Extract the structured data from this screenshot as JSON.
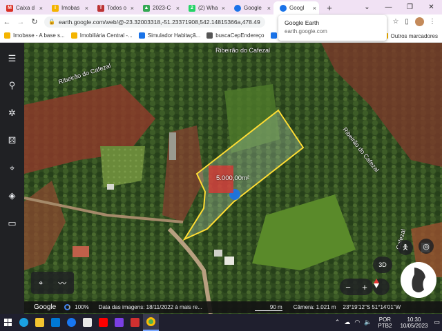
{
  "browser": {
    "tabs": [
      {
        "label": "Caixa d",
        "icon": "gmail-icon",
        "color": "#d93025",
        "letter": "M"
      },
      {
        "label": "Imobas",
        "icon": "imobase-icon",
        "color": "#f4b400",
        "letter": "i"
      },
      {
        "label": "Todos o",
        "icon": "todos-icon",
        "color": "#b33",
        "letter": "T"
      },
      {
        "label": "2023-C",
        "icon": "drive-icon",
        "color": "#34a853",
        "letter": "▲"
      },
      {
        "label": "(2) Wha",
        "icon": "whatsapp-icon",
        "color": "#25d366",
        "letter": "2"
      },
      {
        "label": "Google",
        "icon": "google-earth-icon",
        "color": "#1a73e8",
        "letter": ""
      },
      {
        "label": "Googl",
        "icon": "google-earth-icon",
        "color": "#1a73e8",
        "letter": "",
        "active": true
      }
    ],
    "new_tab": "+",
    "url": "earth.google.com/web/@-23.32003318,-51.23371908,542.14815366a,478.49",
    "tooltip": {
      "title": "Google Earth",
      "subtitle": "earth.google.com"
    },
    "bookmarks": [
      {
        "label": "Imobase - A base s...",
        "color": "#f4b400"
      },
      {
        "label": "Imobiliária Central -...",
        "color": "#f4b400"
      },
      {
        "label": "Simulador Habitaçã...",
        "color": "#1a73e8"
      },
      {
        "label": "buscaCepEndereço",
        "color": "#555555"
      },
      {
        "label": "Selecionar Endereço",
        "color": "#1a73e8"
      }
    ],
    "bookmarks_other": "Outros marcadores"
  },
  "map": {
    "labels": {
      "river_top": "Ribeirão do Cafezal",
      "river_left": "Ribeirão do Cafezal",
      "river_right": "Ribeirão do Cafezal",
      "river_small": "Cafezal",
      "area": "5.000,00m²"
    },
    "controls": {
      "three_d": "3D",
      "zoom_out": "−",
      "zoom_in": "+"
    }
  },
  "status": {
    "logo": "Google",
    "load": "100%",
    "imagery_date": "Data das imagens: 18/11/2022 à mais re...",
    "scale": "90 m",
    "camera": "Câmera: 1.021 m",
    "coords": "23°19'12\"S 51°14'01\"W"
  },
  "taskbar": {
    "lang_top": "POR",
    "lang_bottom": "PTB2",
    "time": "10:30",
    "date": "10/05/2023"
  },
  "colors": {
    "property_outline": "#ffdd33",
    "accent": "#1a73e8"
  }
}
